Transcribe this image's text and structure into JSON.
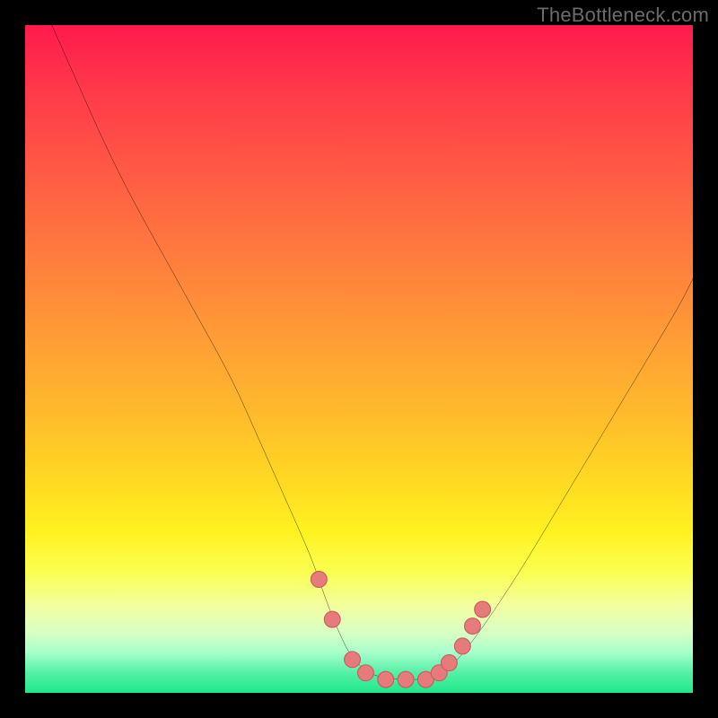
{
  "watermark": "TheBottleneck.com",
  "colors": {
    "frame": "#000000",
    "curve_stroke": "#000000",
    "marker_fill": "#e77a7a",
    "marker_stroke": "#c95c5c",
    "gradient_stops": [
      "#ff1a4d",
      "#ff3a4a",
      "#ff5a44",
      "#ff7a3e",
      "#ff9a36",
      "#ffba2c",
      "#ffd822",
      "#fff220",
      "#fbff52",
      "#f2ffa0",
      "#d8ffc5",
      "#a6ffcb",
      "#54f0a6",
      "#1fe88a"
    ]
  },
  "chart_data": {
    "type": "line",
    "title": "",
    "xlabel": "",
    "ylabel": "",
    "xlim": [
      0,
      100
    ],
    "ylim": [
      0,
      100
    ],
    "grid": false,
    "legend": false,
    "series": [
      {
        "name": "bottleneck-curve",
        "x": [
          4,
          8,
          12,
          16,
          21,
          26,
          31,
          35,
          39,
          43,
          45,
          47,
          49,
          52,
          56,
          60,
          62,
          64,
          68,
          74,
          80,
          86,
          92,
          98,
          100
        ],
        "values": [
          100,
          91,
          82,
          74,
          65,
          56,
          47,
          38,
          29,
          20,
          14,
          9,
          5,
          2.5,
          2,
          2,
          2.5,
          4,
          9,
          18,
          28,
          38,
          48,
          58,
          62
        ]
      }
    ],
    "markers": [
      {
        "x": 44,
        "y": 17
      },
      {
        "x": 46,
        "y": 11
      },
      {
        "x": 49,
        "y": 5
      },
      {
        "x": 51,
        "y": 3
      },
      {
        "x": 54,
        "y": 2
      },
      {
        "x": 57,
        "y": 2
      },
      {
        "x": 60,
        "y": 2
      },
      {
        "x": 62,
        "y": 3
      },
      {
        "x": 63.5,
        "y": 4.5
      },
      {
        "x": 65.5,
        "y": 7
      },
      {
        "x": 67,
        "y": 10
      },
      {
        "x": 68.5,
        "y": 12.5
      }
    ]
  }
}
